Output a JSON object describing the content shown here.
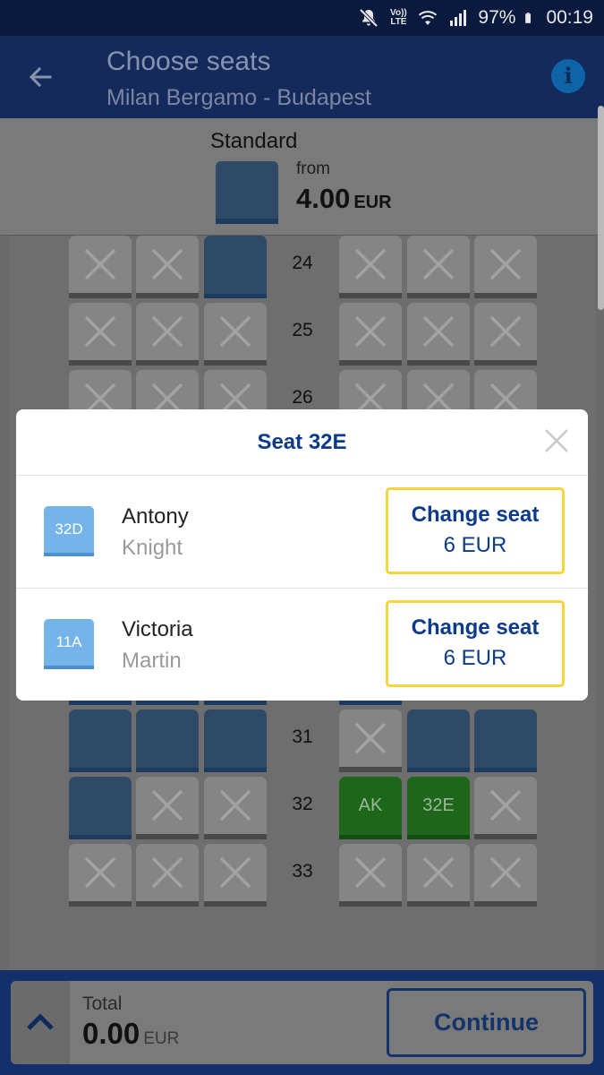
{
  "status_bar": {
    "volte": "Vo)) LTE",
    "battery": "97%",
    "time": "00:19"
  },
  "header": {
    "title": "Choose seats",
    "route": "Milan Bergamo - Budapest",
    "back_icon": "arrow-left-icon",
    "info_icon": "info-icon"
  },
  "fare": {
    "name": "Standard",
    "from_label": "from",
    "price": "4.00",
    "currency": "EUR",
    "swatch_color": "#2e4a66"
  },
  "seatmap": {
    "rows": [
      {
        "label": "24",
        "left": [
          "x",
          "x",
          "avail"
        ],
        "right": [
          "x",
          "x",
          "x"
        ]
      },
      {
        "label": "25",
        "left": [
          "x",
          "x",
          "x"
        ],
        "right": [
          "x",
          "x",
          "x"
        ]
      },
      {
        "label": "26",
        "left": [
          "x",
          "x",
          "x"
        ],
        "right": [
          "x",
          "x",
          "x"
        ]
      },
      {
        "label": "31",
        "left": [
          "avail",
          "avail",
          "avail"
        ],
        "right": [
          "x",
          "avail",
          "avail"
        ]
      },
      {
        "label": "32",
        "left": [
          "avail",
          "x",
          "x"
        ],
        "right": [
          "AK",
          "32E",
          "x"
        ]
      },
      {
        "label": "33",
        "left": [
          "x",
          "x",
          "x"
        ],
        "right": [
          "x",
          "x",
          "x"
        ]
      }
    ],
    "colors": {
      "available": "#2e4a66",
      "occupied": "#858585",
      "selected": "#1e6619"
    }
  },
  "dialog": {
    "title": "Seat 32E",
    "close_icon": "close-icon",
    "passengers": [
      {
        "seat": "32D",
        "first_name": "Antony",
        "last_name": "Knight",
        "button_label": "Change seat",
        "button_price": "6 EUR"
      },
      {
        "seat": "11A",
        "first_name": "Victoria",
        "last_name": "Martin",
        "button_label": "Change seat",
        "button_price": "6 EUR"
      }
    ],
    "accent_color": "#0d3b8c",
    "button_border_color": "#f3d53c"
  },
  "bottom": {
    "total_label": "Total",
    "total_value": "0.00",
    "total_currency": "EUR",
    "continue_label": "Continue",
    "expand_icon": "chevron-up-icon"
  }
}
